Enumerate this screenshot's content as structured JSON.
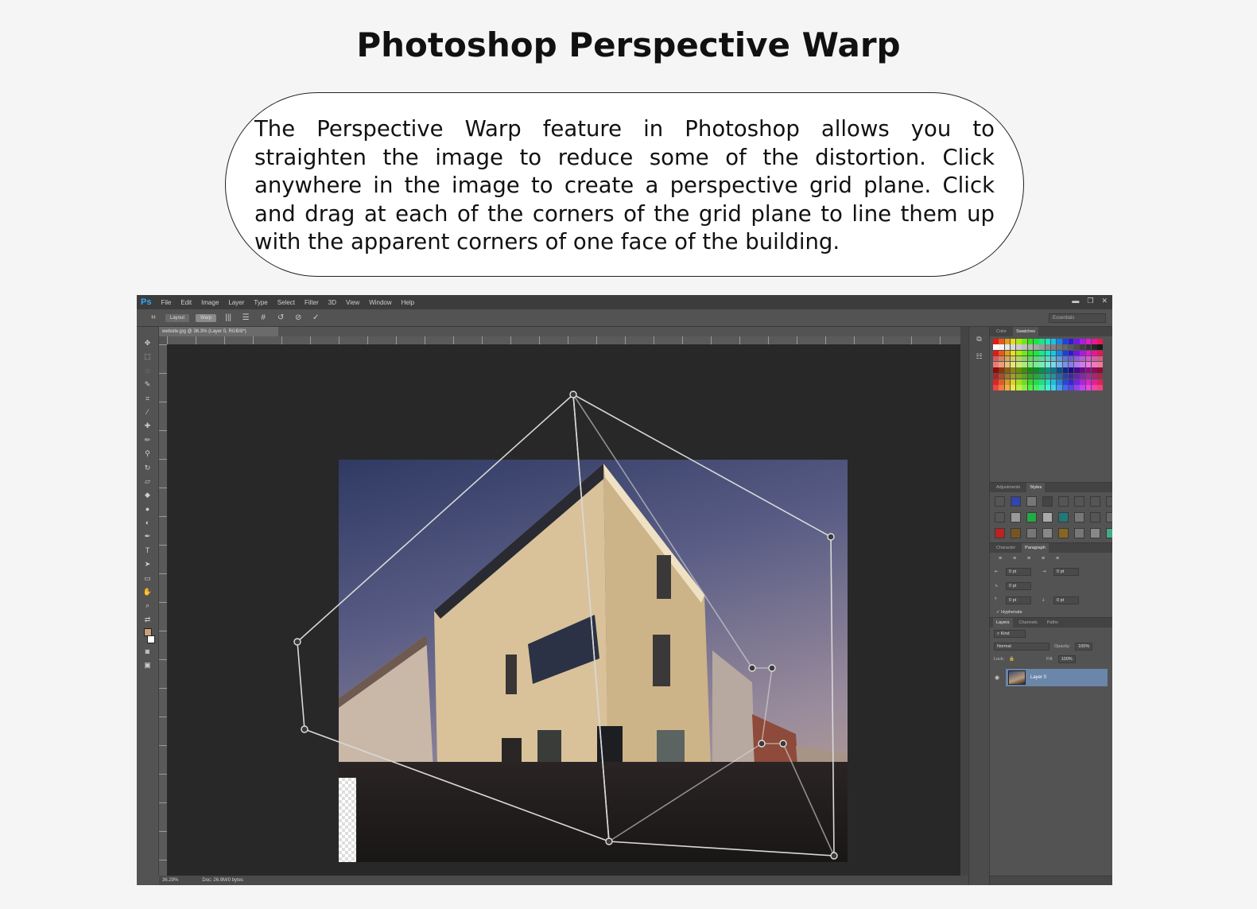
{
  "page": {
    "title": "Photoshop Perspective Warp",
    "description": "The Perspective Warp feature in Photoshop allows you to straighten the image to reduce some of the distortion. Click anywhere in the image to create a perspective grid plane. Click and drag at each of the corners of the grid plane to line them up with the apparent corners of one face of the building."
  },
  "photoshop": {
    "logo": "Ps",
    "menu": [
      "File",
      "Edit",
      "Image",
      "Layer",
      "Type",
      "Select",
      "Filter",
      "3D",
      "View",
      "Window",
      "Help"
    ],
    "window_controls": [
      "▬",
      "❐",
      "✕"
    ],
    "options": {
      "layout_label": "Layout",
      "warp_label": "Warp",
      "workspace": "Essentials"
    },
    "document_tab": "website.jpg @ 36.3% (Layer 0, RGB/8*)",
    "status": {
      "zoom": "36.29%",
      "doc": "Doc: 26.9M/0 bytes"
    },
    "panels": {
      "color_tabs": [
        "Color",
        "Swatches"
      ],
      "active_color_tab": "Swatches",
      "adjust_tabs": [
        "Adjustments",
        "Styles"
      ],
      "active_adjust_tab": "Styles",
      "para_tabs": [
        "Character",
        "Paragraph"
      ],
      "active_para_tab": "Paragraph",
      "para_value": "0 pt",
      "hyphenate": "Hyphenate",
      "layers_tabs": [
        "Layers",
        "Channels",
        "Paths"
      ],
      "active_layers_tab": "Layers",
      "kind_label": "Kind",
      "blend_mode": "Normal",
      "opacity_label": "Opacity:",
      "opacity_value": "100%",
      "lock_label": "Lock:",
      "fill_label": "Fill:",
      "fill_value": "100%",
      "layer_name": "Layer 0"
    }
  },
  "colors": {
    "ps_accent": "#31a8ff",
    "layer_selected": "#6a86a8",
    "canvas_bg": "#282828",
    "warp_grid": "#d8d8d8"
  }
}
